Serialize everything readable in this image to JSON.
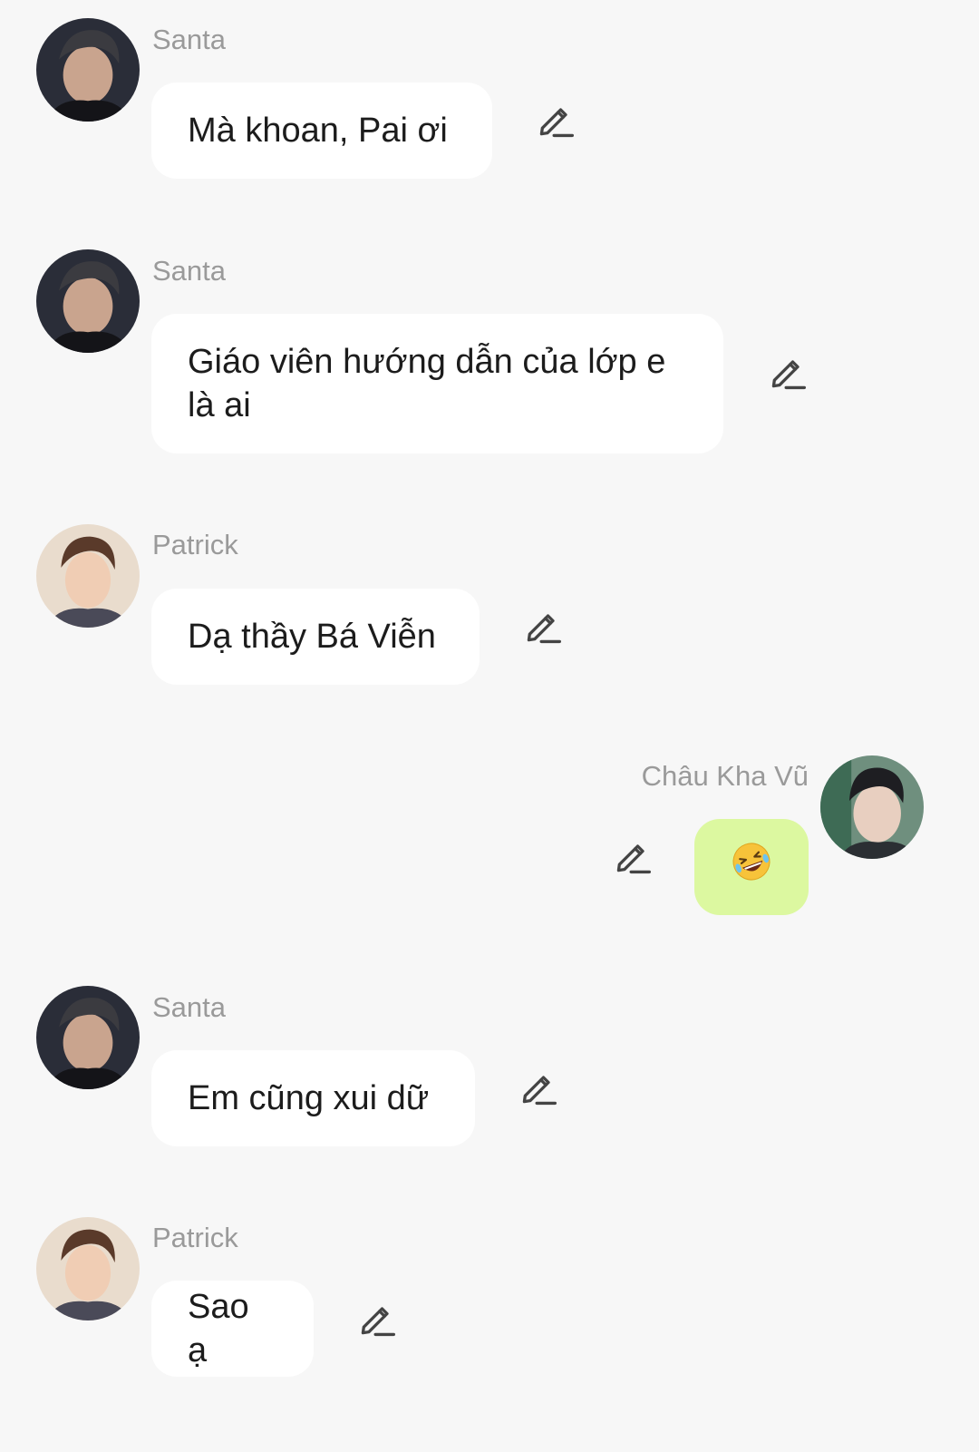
{
  "messages": [
    {
      "sender": "Santa",
      "text": "Mà khoan, Pai ơi"
    },
    {
      "sender": "Santa",
      "text": "Giáo viên hướng dẫn của lớp e là ai"
    },
    {
      "sender": "Patrick",
      "text": "Dạ thầy Bá Viễn"
    },
    {
      "sender": "Châu Kha Vũ",
      "text": ""
    },
    {
      "sender": "Santa",
      "text": "Em cũng xui dữ"
    },
    {
      "sender": "Patrick",
      "text": "Sao ạ"
    }
  ],
  "icons": {
    "edit": "pencil-edit-icon",
    "emoji": "rolling-on-floor-laughing-emoji"
  },
  "colors": {
    "background": "#f7f7f7",
    "bubble": "#ffffff",
    "own_bubble": "#dcf8a0",
    "name": "#9a9a9a"
  }
}
